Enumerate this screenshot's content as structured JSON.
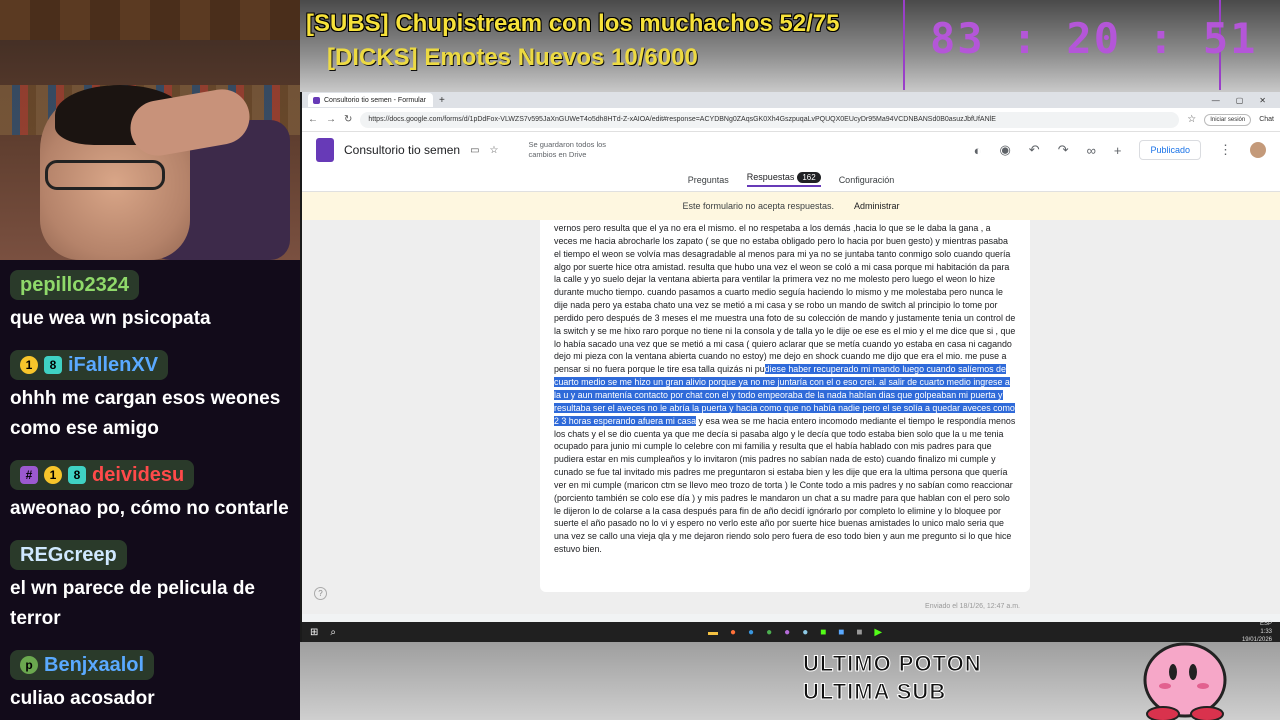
{
  "overlay": {
    "title": "[SUBS] Chupistream con los muchachos 52/75",
    "subtitle": "[DICKS] Emotes Nuevos 10/6000",
    "timer": "83 : 20 : 51",
    "bottom_text_1": "ULTIMO POTON",
    "bottom_text_2": "ULTIMA SUB"
  },
  "chat": [
    {
      "user": "pepillo2324",
      "color": "#8fd96a",
      "badges": [],
      "text": "que wea wn psicopata"
    },
    {
      "user": "iFallenXV",
      "color": "#5aa9ff",
      "badges": [
        "1",
        "8"
      ],
      "text": "ohhh me cargan esos weones como ese amigo"
    },
    {
      "user": "deividesu",
      "color": "#ff4a4a",
      "badges": [
        "#",
        "1",
        "8"
      ],
      "text": "aweonao po, cómo no contarle"
    },
    {
      "user": "REGcreep",
      "color": "#cfe8ff",
      "badges": [],
      "text": "el wn parece de pelicula de terror"
    },
    {
      "user": "Benjxaalol",
      "color": "#5aa9ff",
      "badges": [
        "p"
      ],
      "text": "culiao acosador"
    }
  ],
  "browser": {
    "tab_title": "Consultorio tio semen - Formular",
    "new_tab": "+",
    "url": "https://docs.google.com/forms/d/1pDdFox-VLWZS7v595JaXnGUWeT4o5dh8HTd-Z-xAIOA/edit#response=ACYDBNg0ZAqsGK0Xh4GszpuqaLvPQUQX0EUcyDr95Ma94VCDNBANSd0B0asuzJbfUfANlE",
    "signin": "Iniciar sesión",
    "chat": "Chat"
  },
  "form": {
    "title": "Consultorio tio semen",
    "saved": "Se guardaron todos los cambios en Drive",
    "publish": "Publicado",
    "tabs": {
      "questions": "Preguntas",
      "responses": "Respuestas",
      "count": "162",
      "settings": "Configuración"
    },
    "banner": "Este formulario no acepta respuestas.",
    "admin": "Administrar",
    "response_pre": "vernos pero resulta que el ya no era el mismo. el no respetaba a los demás ,hacia lo que se le daba la gana , a veces me hacia abrocharle los zapato ( se que no estaba obligado pero lo hacia por buen gesto) y mientras pasaba el tiempo el weon se volvía mas desagradable al menos para mi ya no se juntaba tanto conmigo solo cuando quería algo por suerte hice otra amistad. resulta que hubo una vez el weon se coló a mi casa porque mi habitación da para la calle y yo suelo dejar la ventana abierta para ventilar la primera vez no me molesto pero luego el weon lo hize durante mucho tiempo. cuando pasamos a cuarto medio seguía haciendo lo mismo y me molestaba pero nunca le dije nada pero ya estaba chato una vez se metió a mi casa y se robo un mando de switch al principio lo tome por perdido pero después de 3 meses el me muestra una foto de su colección de mando y justamente tenia un control de la switch y se me hixo raro porque no tiene ni la consola y de talla yo le dije oe ese es el mio y el me dice que si , que lo había sacado una vez que se metió a mi casa ( quiero aclarar que se metía cuando yo estaba en casa ni cagando dejo mi pieza con la ventana abierta cuando no estoy) me dejo en shock cuando me dijo que era el mio. me puse a pensar si no fuera porque le tire esa talla quizás ni pu",
    "response_hl": "diese haber recuperado mi mando luego cuando salíemos de cuarto medio se me hizo un gran alivio porque ya no me juntaría con el o eso crei. al salir de cuarto medio ingrese a la u y aun mantenía contacto por chat con el  y todo empeoraba de la nada habían dias que golpeaban mi puerta y resultaba ser el aveces no le abría la puerta y hacia como que no había nadie pero el se solía a quedar aveces como 2 3 horas esperando afuera mi casa",
    "response_post": " y esa wea se me hacia entero incomodo mediante el tiempo le respondía menos los chats y el se dio cuenta ya que me decía si pasaba algo y le decía que todo estaba bien solo que la u me tenia ocupado para junio mi cumple lo celebre con mi familia y resulta que el había hablado con mis padres para que pudiera estar en mis cumpleaños y lo invitaron (mis padres no sabían nada de esto) cuando finalizo mi cumple y cunado se fue tal invitado mis padres me preguntaron si estaba bien y les dije que era la ultima persona que quería ver en mi cumple (maricon ctm se llevo meo trozo de torta ) le Conte todo a mis padres y no sabían como reaccionar (porciento también se colo ese día ) y mis padres le mandaron un chat a su madre para que hablan con el pero solo le dijeron lo de colarse a la casa después para fin de año decidí ignórarlo por completo lo elimine y lo bloquee por suerte el año pasado no lo vi y espero no verlo este año por suerte hice buenas amistades lo unico malo seria que una vez se callo una vieja qla y me dejaron riendo solo pero fuera de eso todo bien  y aun me pregunto si lo que hice estuvo bien.",
    "sent": "Enviado el 18/1/26, 12:47 a.m."
  },
  "taskbar": {
    "lang": "ESP",
    "time": "1:33",
    "date": "19/01/2026"
  }
}
